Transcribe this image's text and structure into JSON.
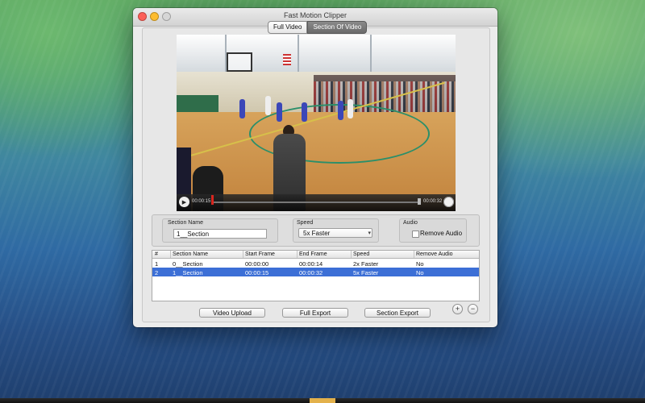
{
  "window": {
    "title": "Fast Motion Clipper"
  },
  "tabs": [
    {
      "label": "Full Video"
    },
    {
      "label": "Section Of Video"
    }
  ],
  "player": {
    "current_time": "00:00:15",
    "end_time": "00:00:32",
    "play_icon": "play-icon",
    "volume_icon": "volume-icon"
  },
  "section_form": {
    "name_label": "Section Name",
    "name_value": "1__Section",
    "speed_label": "Speed",
    "speed_value": "5x Faster",
    "audio_label": "Audio",
    "remove_audio_label": "Remove Audio",
    "remove_audio_checked": false
  },
  "table": {
    "columns": [
      "#",
      "Section Name",
      "Start Frame",
      "End Frame",
      "Speed",
      "Remove Audio"
    ],
    "rows": [
      {
        "index": "1",
        "name": "0__Section",
        "start": "00:00:00",
        "end": "00:00:14",
        "speed": "2x Faster",
        "remove_audio": "No",
        "selected": false
      },
      {
        "index": "2",
        "name": "1__Section",
        "start": "00:00:15",
        "end": "00:00:32",
        "speed": "5x Faster",
        "remove_audio": "No",
        "selected": true
      }
    ]
  },
  "buttons": {
    "video_upload": "Video Upload",
    "full_export": "Full Export",
    "section_export": "Section Export",
    "add": "+",
    "remove": "−"
  },
  "colors": {
    "selection": "#3c6fd6",
    "window_bg": "#ececec"
  }
}
